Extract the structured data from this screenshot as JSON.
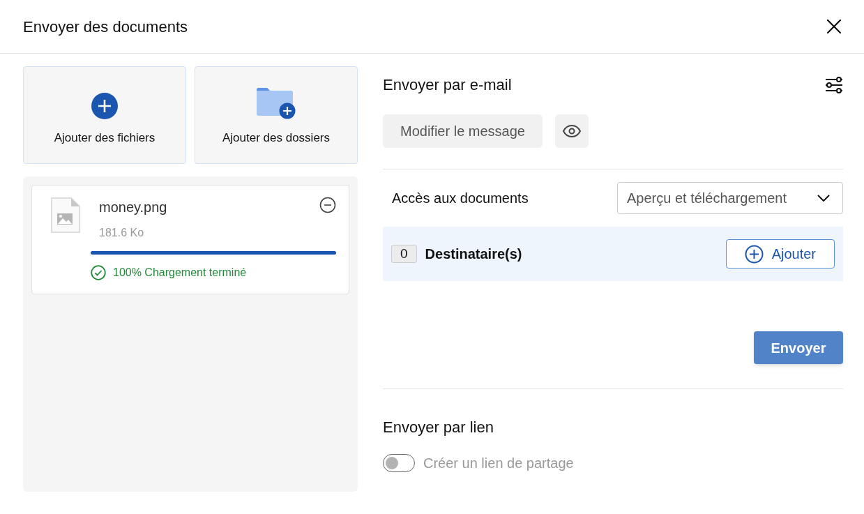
{
  "dialog": {
    "title": "Envoyer des documents"
  },
  "add_buttons": [
    {
      "kind": "files",
      "label": "Ajouter des fichiers"
    },
    {
      "kind": "folders",
      "label": "Ajouter des dossiers"
    }
  ],
  "files": [
    {
      "name": "money.png",
      "size": "181.6 Ko",
      "level": 1,
      "status": "100% Chargement terminé"
    }
  ],
  "email": {
    "title": "Envoyer par e-mail",
    "edit_button": "Modifier le message",
    "access_label": "Accès aux documents",
    "access_value": "Aperçu et téléchargement",
    "recipient_count": "0",
    "recipients_label": "Destinataire(s)",
    "add_button": "Ajouter",
    "send_button": "Envoyer"
  },
  "link": {
    "title": "Envoyer par lien",
    "toggle_label": "Créer un lien de partage",
    "on": false
  }
}
